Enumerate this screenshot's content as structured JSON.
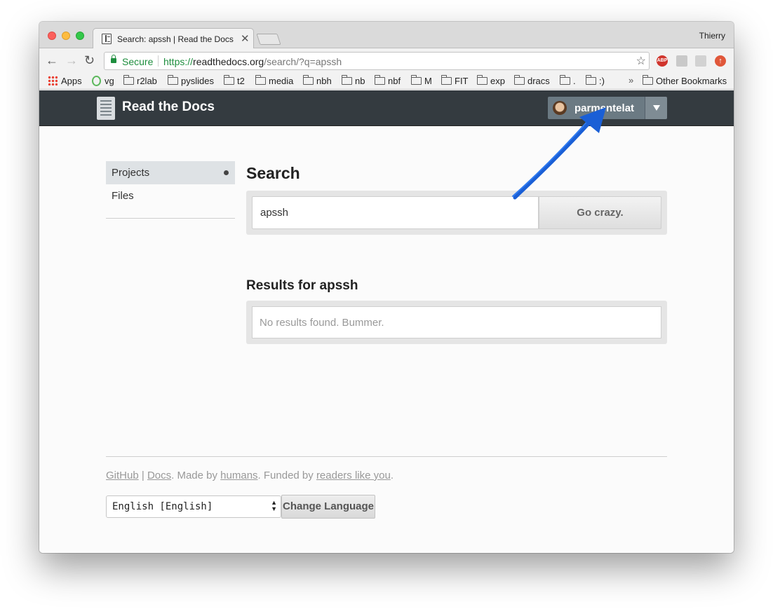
{
  "browser": {
    "tab": {
      "title": "Search: apssh | Read the Docs"
    },
    "profile_name": "Thierry",
    "address_bar": {
      "secure_label": "Secure",
      "url_scheme": "https://",
      "url_host": "readthedocs.org",
      "url_path": "/search/?q=apssh"
    },
    "extensions": [
      "ABP",
      "Drive",
      "Save",
      "Upload"
    ],
    "bookmarks": [
      {
        "label": "Apps",
        "icon": "apps-icon"
      },
      {
        "label": "vg",
        "icon": "vg-icon"
      },
      {
        "label": "r2lab",
        "icon": "folder-icon"
      },
      {
        "label": "pyslides",
        "icon": "folder-icon"
      },
      {
        "label": "t2",
        "icon": "folder-icon"
      },
      {
        "label": "media",
        "icon": "folder-icon"
      },
      {
        "label": "nbh",
        "icon": "folder-icon"
      },
      {
        "label": "nb",
        "icon": "folder-icon"
      },
      {
        "label": "nbf",
        "icon": "folder-icon"
      },
      {
        "label": "M",
        "icon": "folder-icon"
      },
      {
        "label": "FIT",
        "icon": "folder-icon"
      },
      {
        "label": "exp",
        "icon": "folder-icon"
      },
      {
        "label": "dracs",
        "icon": "folder-icon"
      },
      {
        "label": ".",
        "icon": "folder-icon"
      },
      {
        "label": ":)",
        "icon": "folder-icon"
      }
    ],
    "bookmarks_overflow": "»",
    "other_bookmarks": "Other Bookmarks"
  },
  "site": {
    "logo_text": "Read the Docs",
    "username": "parmentelat"
  },
  "sidebar": {
    "items": [
      {
        "label": "Projects",
        "active": true
      },
      {
        "label": "Files",
        "active": false
      }
    ]
  },
  "search": {
    "heading": "Search",
    "query": "apssh",
    "button": "Go crazy."
  },
  "results": {
    "heading": "Results for apssh",
    "empty_message": "No results found. Bummer."
  },
  "footer": {
    "github": "GitHub",
    "separator": "|",
    "docs": "Docs",
    "made_by": ". Made by ",
    "humans": "humans",
    "funded_by": ". Funded by ",
    "readers": "readers like you",
    "end": ".",
    "language_value": "English [English]",
    "change_language": "Change Language"
  },
  "colors": {
    "header_bg": "#343b40",
    "user_menu_bg": "#6b7a83",
    "secure_green": "#1e8e3e",
    "annotation_arrow": "#1a5fd6"
  }
}
